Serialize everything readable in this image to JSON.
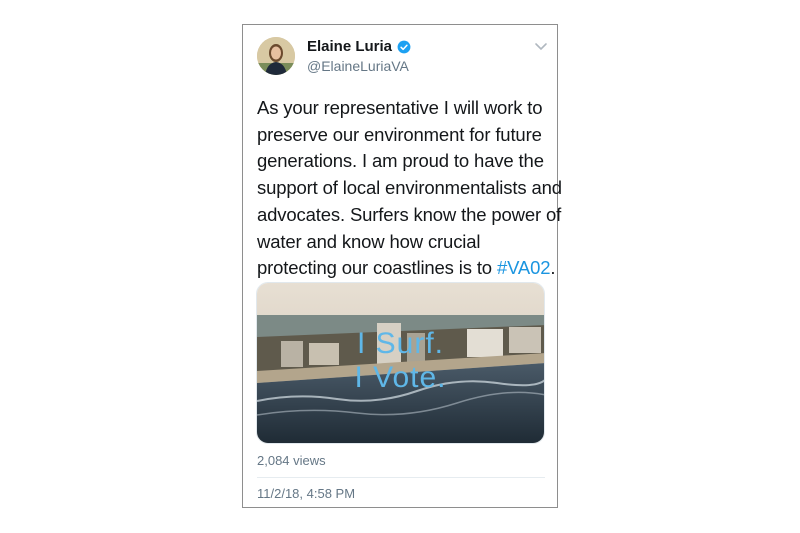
{
  "tweet": {
    "author_name": "Elaine Luria",
    "author_handle": "@ElaineLuriaVA",
    "text_lines": [
      "As your representative I will work to",
      "preserve our environment for future",
      "generations. I am proud to have the",
      "support of local environmentalists and",
      "advocates. Surfers know the power of",
      "water and know how crucial"
    ],
    "text_last_line_prefix": "protecting our coastlines is to ",
    "hashtag": "#VA02",
    "text_last_line_suffix": ".",
    "media": {
      "overlay_line_1": "I Surf.",
      "overlay_line_2": "I Vote."
    },
    "views": "2,084 views",
    "timestamp": "11/2/18, 4:58 PM"
  },
  "icons": {
    "verified": "verified-badge-icon",
    "menu": "chevron-down-icon",
    "avatar": "profile-photo"
  },
  "colors": {
    "hashtag": "#1b95e0",
    "verified": "#1da1f2",
    "secondary_text": "#657786",
    "overlay_text": "#5fb7e8"
  }
}
